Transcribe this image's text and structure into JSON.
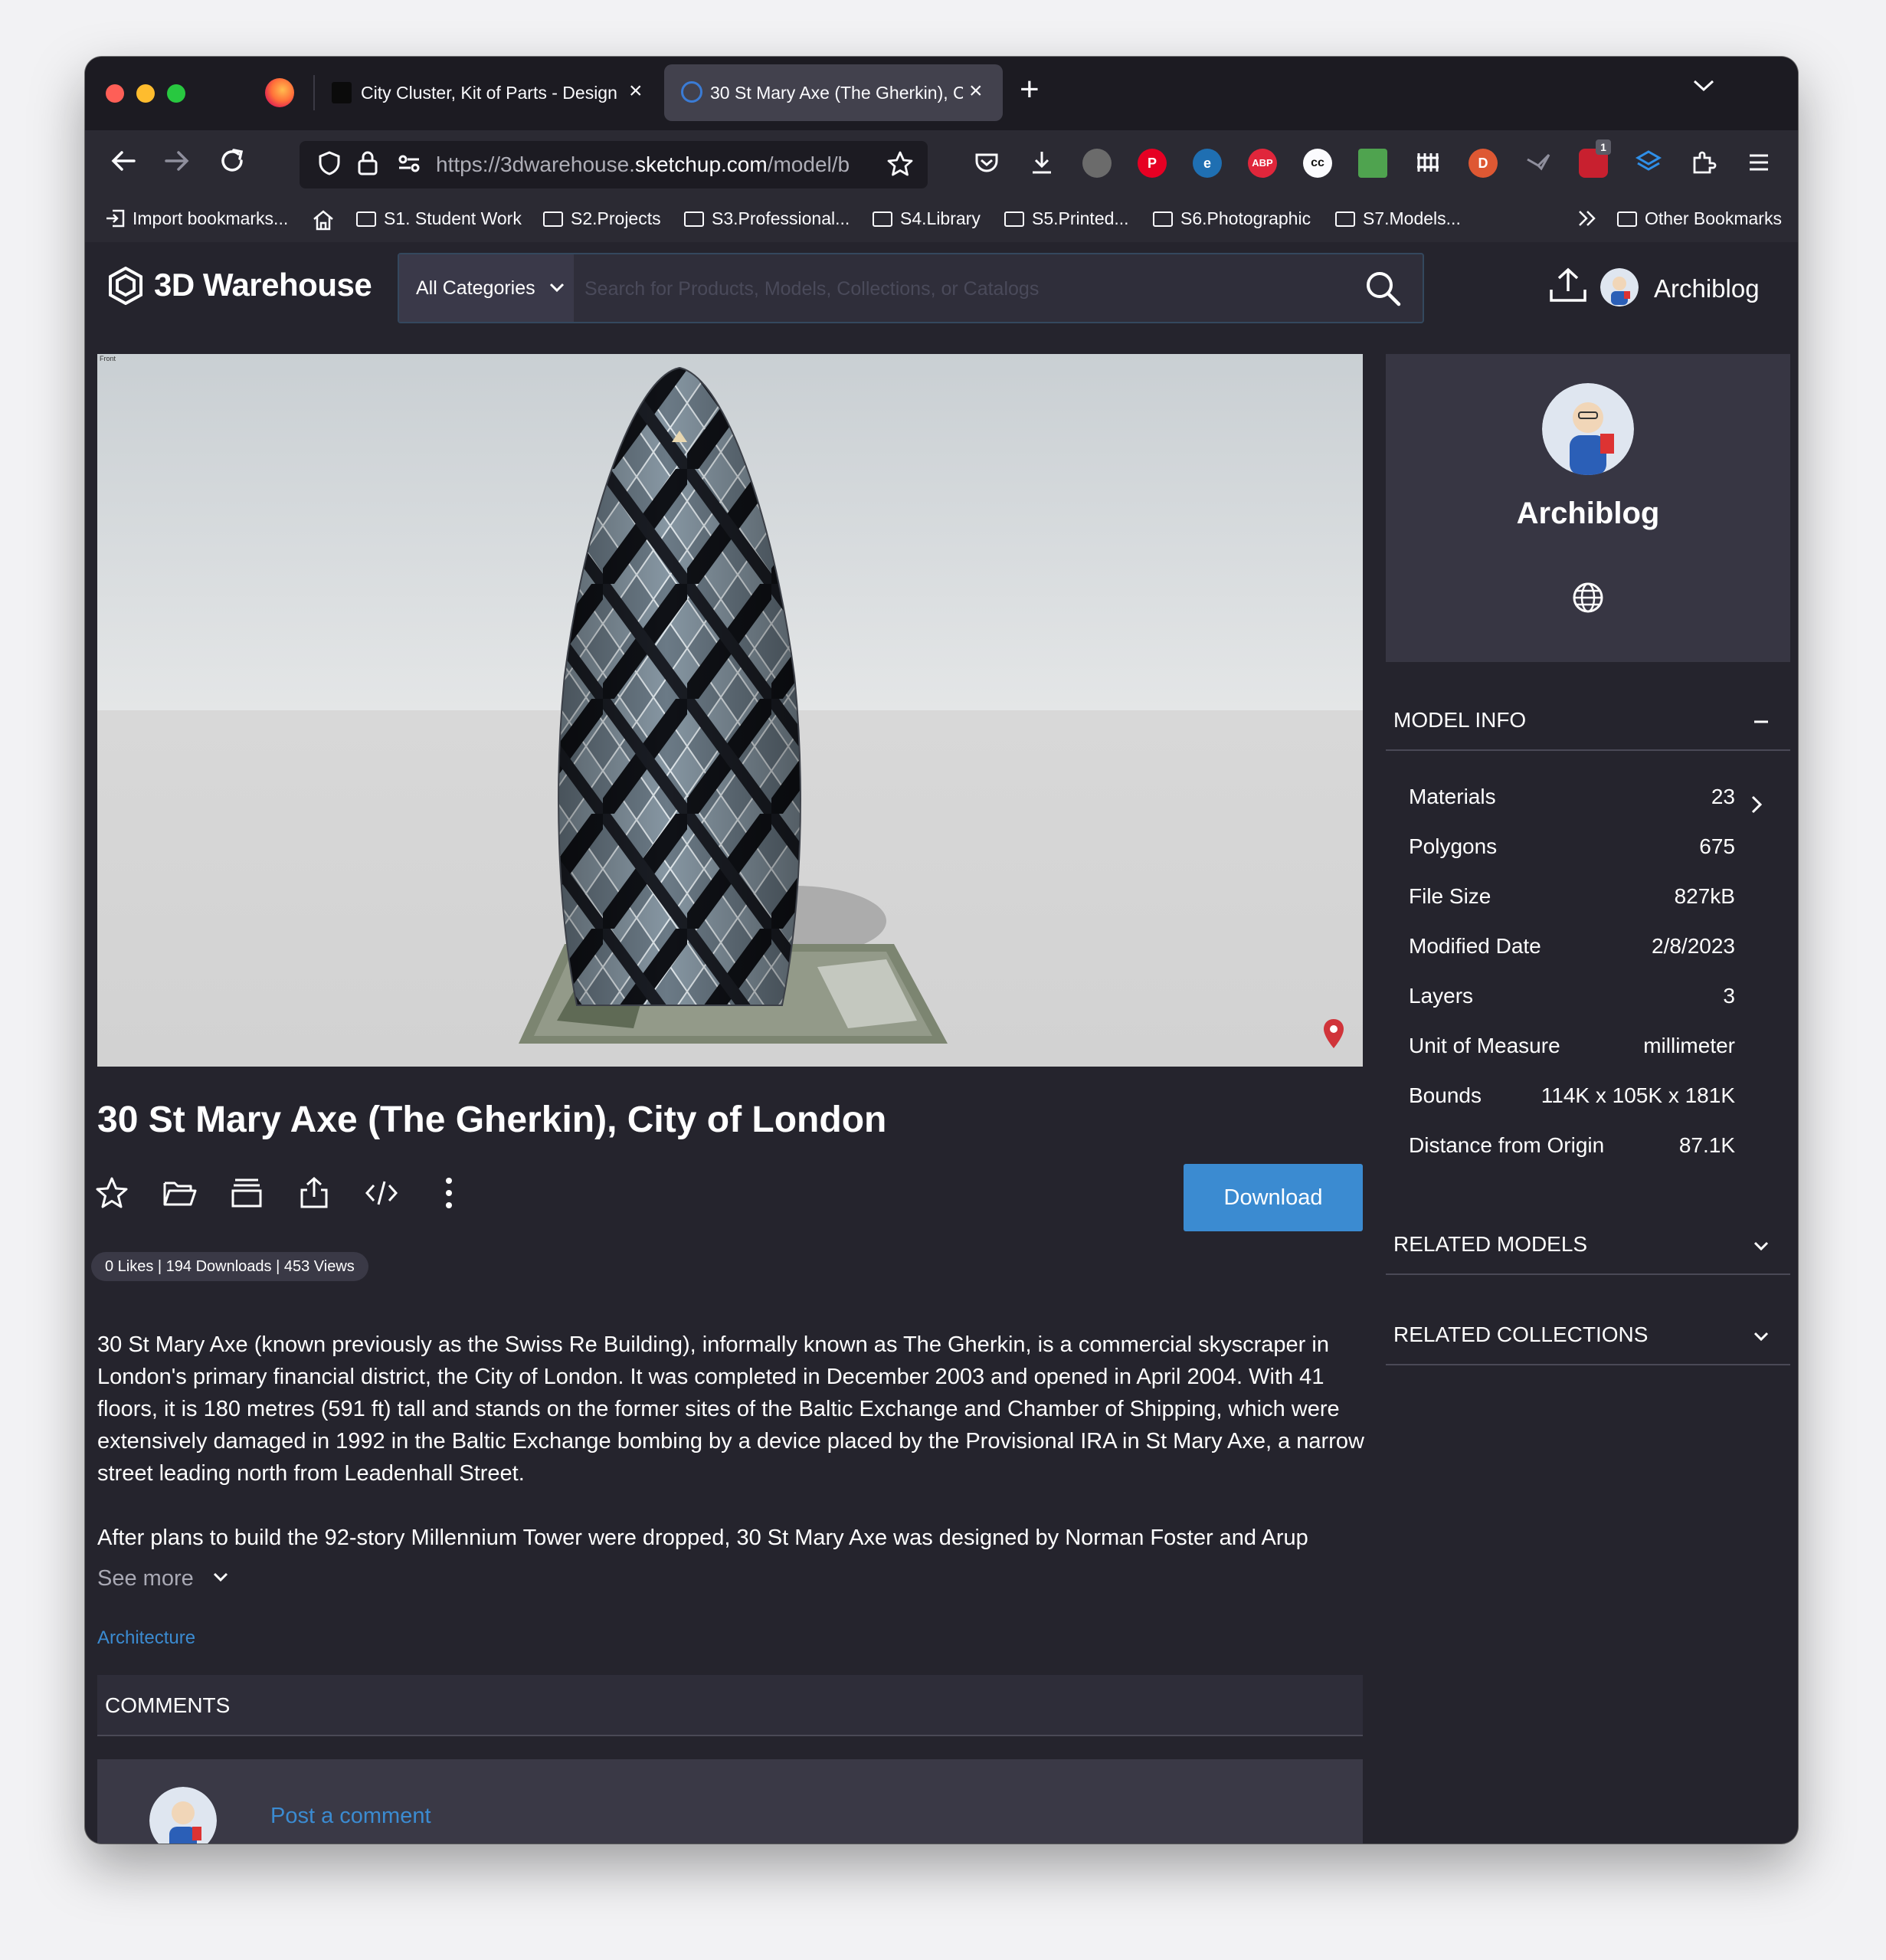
{
  "browser": {
    "tabs": [
      {
        "title": "City Cluster, Kit of Parts - Design",
        "active": false
      },
      {
        "title": "30 St Mary Axe (The Gherkin), C",
        "active": true
      }
    ],
    "url_prefix": "https://3dwarehouse.",
    "url_host": "sketchup.com",
    "url_path": "/model/b",
    "extension_badge": "1",
    "bookmarks": [
      {
        "label": "Import bookmarks...",
        "type": "import"
      },
      {
        "label": "S1. Student Work",
        "type": "folder"
      },
      {
        "label": "S2.Projects",
        "type": "folder"
      },
      {
        "label": "S3.Professional...",
        "type": "folder"
      },
      {
        "label": "S4.Library",
        "type": "folder"
      },
      {
        "label": "S5.Printed...",
        "type": "folder"
      },
      {
        "label": "S6.Photographic",
        "type": "folder"
      },
      {
        "label": "S7.Models...",
        "type": "folder"
      },
      {
        "label": "Other Bookmarks",
        "type": "folder"
      }
    ]
  },
  "site": {
    "brand": "3D Warehouse",
    "category_button": "All Categories",
    "search_placeholder": "Search for Products, Models, Collections, or Catalogs",
    "username": "Archiblog"
  },
  "model": {
    "viewer_label": "Front",
    "title": "30 St Mary Axe (The Gherkin), City of London",
    "download_label": "Download",
    "stats": "0 Likes | 194 Downloads | 453 Views",
    "description": [
      "30 St Mary Axe (known previously as the Swiss Re Building), informally known as The Gherkin, is a commercial skyscraper in London's primary financial district, the City of London. It was completed in December 2003 and opened in April 2004. With 41 floors, it is 180 metres (591 ft) tall and stands on the former sites of the Baltic Exchange and Chamber of Shipping, which were extensively damaged in 1992 in the Baltic Exchange bombing by a device placed by the Provisional IRA in St Mary Axe, a narrow street leading north from Leadenhall Street.",
      "After plans to build the 92-story Millennium Tower were dropped, 30 St Mary Axe was designed by Norman Foster and Arup"
    ],
    "see_more": "See more",
    "tag": "Architecture"
  },
  "comments": {
    "title": "COMMENTS",
    "post_label": "Post a comment"
  },
  "sidebar": {
    "author": "Archiblog",
    "model_info_title": "MODEL INFO",
    "model_info": [
      {
        "label": "Materials",
        "value": "23"
      },
      {
        "label": "Polygons",
        "value": "675"
      },
      {
        "label": "File Size",
        "value": "827kB"
      },
      {
        "label": "Modified Date",
        "value": "2/8/2023"
      },
      {
        "label": "Layers",
        "value": "3"
      },
      {
        "label": "Unit of Measure",
        "value": "millimeter"
      },
      {
        "label": "Bounds",
        "value": "114K x 105K x 181K"
      },
      {
        "label": "Distance from Origin",
        "value": "87.1K"
      }
    ],
    "related_models_title": "RELATED MODELS",
    "related_collections_title": "RELATED COLLECTIONS"
  },
  "colors": {
    "accent": "#3b8bd1",
    "page_bg": "#25242d",
    "panel_bg": "#373643",
    "location_pin": "#d0343a"
  }
}
